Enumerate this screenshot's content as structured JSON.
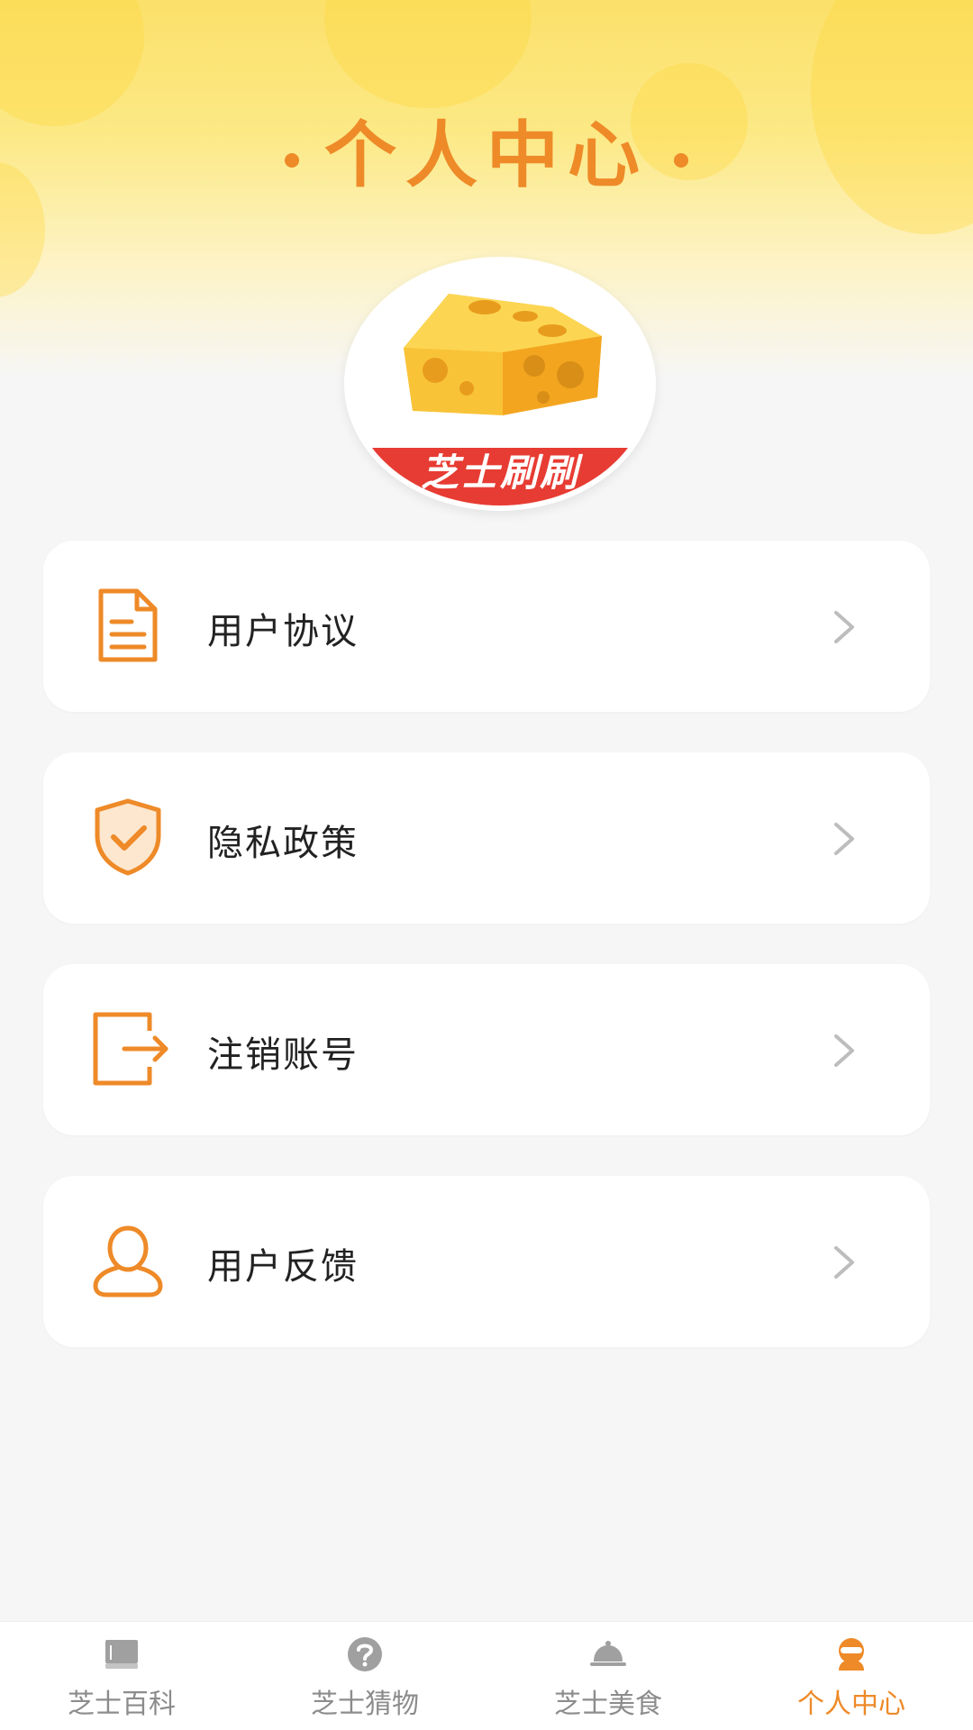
{
  "header": {
    "title": "个人中心",
    "avatar_banner_text": "芝士刷刷"
  },
  "menu": [
    {
      "label": "用户协议",
      "icon": "document-icon"
    },
    {
      "label": "隐私政策",
      "icon": "shield-check-icon"
    },
    {
      "label": "注销账号",
      "icon": "logout-icon"
    },
    {
      "label": "用户反馈",
      "icon": "user-icon"
    }
  ],
  "tabbar": {
    "active": "个人中心",
    "items": [
      {
        "label": "芝士百科",
        "icon": "book-icon"
      },
      {
        "label": "芝士猜物",
        "icon": "question-icon"
      },
      {
        "label": "芝士美食",
        "icon": "food-cloche-icon"
      },
      {
        "label": "个人中心",
        "icon": "profile-icon"
      }
    ]
  },
  "colors": {
    "accent": "#ee8a28",
    "header_yellow": "#fbe06a",
    "background": "#f6f6f6",
    "tab_inactive": "#8c8c8c",
    "banner_red": "#e73c33"
  }
}
